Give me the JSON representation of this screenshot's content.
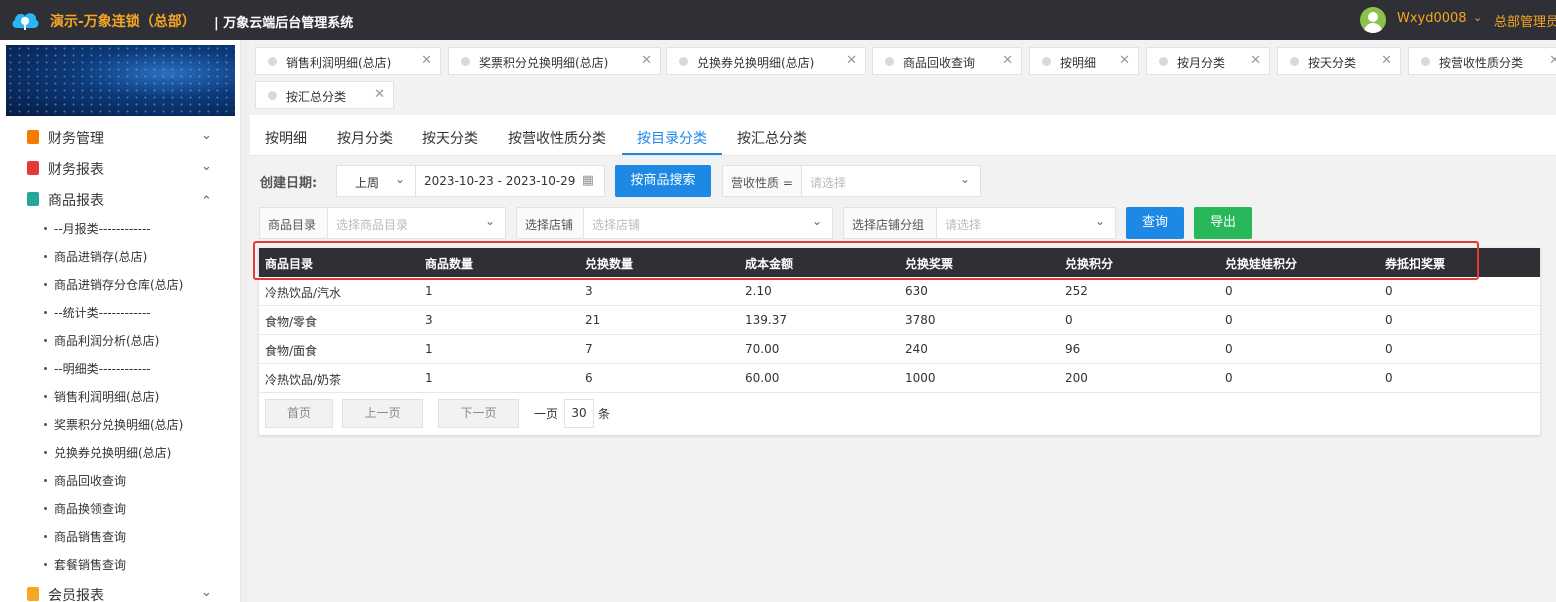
{
  "header": {
    "brand": "演示-万象连锁（总部）",
    "system_name": "| 万象云端后台管理系统",
    "username": "Wxyd0008",
    "role": "总部管理员"
  },
  "sidebar": {
    "groups": [
      {
        "label": "财务管理",
        "expanded": false,
        "icon_color": "#f57c00"
      },
      {
        "label": "财务报表",
        "expanded": false,
        "icon_color": "#e53935"
      },
      {
        "label": "商品报表",
        "expanded": true,
        "icon_color": "#26a69a"
      },
      {
        "label": "会员报表",
        "expanded": false,
        "icon_color": "#f5a623"
      }
    ],
    "items": [
      "--月报类------------",
      "商品进销存(总店)",
      "商品进销存分仓库(总店)",
      "--统计类------------",
      "商品利润分析(总店)",
      "--明细类------------",
      "销售利润明细(总店)",
      "奖票积分兑换明细(总店)",
      "兑换券兑换明细(总店)",
      "商品回收查询",
      "商品换领查询",
      "商品销售查询",
      "套餐销售查询"
    ]
  },
  "page_tabs": [
    "销售利润明细(总店)",
    "奖票积分兑换明细(总店)",
    "兑换券兑换明细(总店)",
    "商品回收查询",
    "按明细",
    "按月分类",
    "按天分类",
    "按营收性质分类",
    "按汇总分类"
  ],
  "sub_tabs": {
    "items": [
      "按明细",
      "按月分类",
      "按天分类",
      "按营收性质分类",
      "按目录分类",
      "按汇总分类"
    ],
    "active": "按目录分类"
  },
  "filters": {
    "date_label": "创建日期:",
    "date_preset": "上周",
    "date_range": "2023-10-23 - 2023-10-29",
    "search_by_product_button": "按商品搜索",
    "revenue_nature_label": "营收性质 =",
    "revenue_nature_placeholder": "请选择",
    "catalog_label": "商品目录",
    "catalog_placeholder": "选择商品目录",
    "store_label": "选择店铺",
    "store_placeholder": "选择店铺",
    "store_group_label": "选择店铺分组",
    "store_group_placeholder": "请选择",
    "query_button": "查询",
    "export_button": "导出"
  },
  "table": {
    "columns": [
      "商品目录",
      "商品数量",
      "兑换数量",
      "成本金额",
      "兑换奖票",
      "兑换积分",
      "兑换娃娃积分",
      "券抵扣奖票"
    ],
    "rows": [
      [
        "冷热饮品/汽水",
        "1",
        "3",
        "2.10",
        "630",
        "252",
        "0",
        "0"
      ],
      [
        "食物/零食",
        "3",
        "21",
        "139.37",
        "3780",
        "0",
        "0",
        "0"
      ],
      [
        "食物/面食",
        "1",
        "7",
        "70.00",
        "240",
        "96",
        "0",
        "0"
      ],
      [
        "冷热饮品/奶茶",
        "1",
        "6",
        "60.00",
        "1000",
        "200",
        "0",
        "0"
      ]
    ]
  },
  "pagination": {
    "first": "首页",
    "prev": "上一页",
    "next": "下一页",
    "per_page_label": "一页",
    "per_page_value": "30",
    "per_page_unit": "条"
  },
  "colors": {
    "accent": "#1e88e5",
    "export": "#28b85a",
    "header_bg": "#2f3036",
    "brand": "#f5a623",
    "highlight": "#e53935"
  }
}
